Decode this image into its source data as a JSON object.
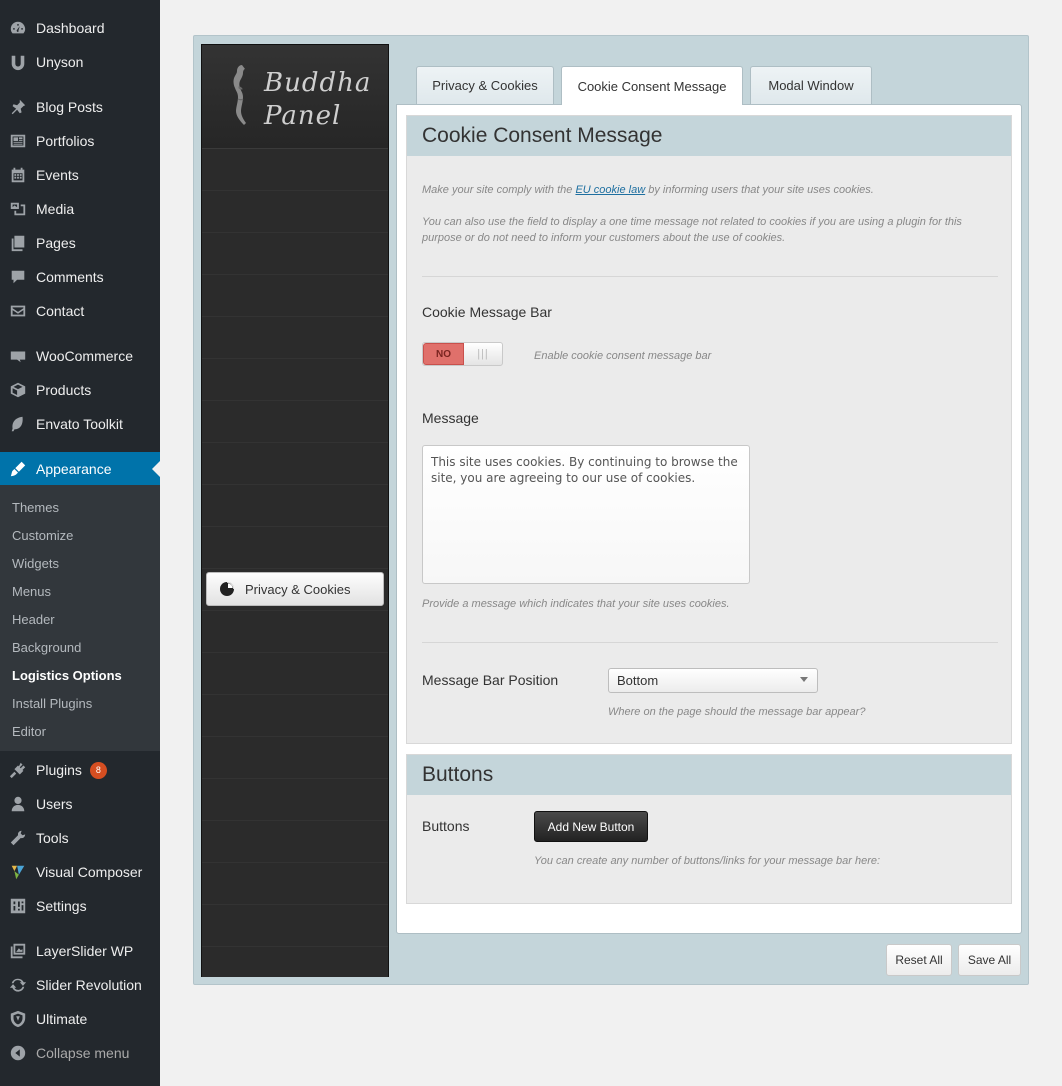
{
  "sidebar": {
    "items": [
      {
        "label": "Dashboard",
        "icon": "dashboard-icon"
      },
      {
        "label": "Unyson",
        "icon": "unyson-icon"
      },
      {
        "label": "Blog Posts",
        "icon": "pin-icon"
      },
      {
        "label": "Portfolios",
        "icon": "portfolio-icon"
      },
      {
        "label": "Events",
        "icon": "calendar-icon"
      },
      {
        "label": "Media",
        "icon": "media-icon"
      },
      {
        "label": "Pages",
        "icon": "pages-icon"
      },
      {
        "label": "Comments",
        "icon": "comment-icon"
      },
      {
        "label": "Contact",
        "icon": "mail-icon"
      },
      {
        "label": "WooCommerce",
        "icon": "woo-icon"
      },
      {
        "label": "Products",
        "icon": "box-icon"
      },
      {
        "label": "Envato Toolkit",
        "icon": "leaf-icon"
      },
      {
        "label": "Appearance",
        "icon": "brush-icon"
      },
      {
        "label": "Plugins",
        "icon": "plug-icon",
        "badge": "8"
      },
      {
        "label": "Users",
        "icon": "user-icon"
      },
      {
        "label": "Tools",
        "icon": "wrench-icon"
      },
      {
        "label": "Visual Composer",
        "icon": "vc-icon"
      },
      {
        "label": "Settings",
        "icon": "settings-icon"
      },
      {
        "label": "LayerSlider WP",
        "icon": "layers-icon"
      },
      {
        "label": "Slider Revolution",
        "icon": "refresh-icon"
      },
      {
        "label": "Ultimate",
        "icon": "shield-icon"
      },
      {
        "label": "Collapse menu",
        "icon": "collapse-icon"
      }
    ],
    "submenu": [
      "Themes",
      "Customize",
      "Widgets",
      "Menus",
      "Header",
      "Background",
      "Logistics Options",
      "Install Plugins",
      "Editor"
    ],
    "active_sub": "Logistics Options",
    "accent": "#0073aa",
    "badge_color": "#d54e21"
  },
  "panel": {
    "logo_line1": "Buddha",
    "logo_line2": "Panel",
    "nav_item": "Privacy & Cookies",
    "tabs": [
      "Privacy & Cookies",
      "Cookie Consent Message",
      "Modal Window"
    ],
    "active_tab": "Cookie Consent Message",
    "section1_title": "Cookie Consent Message",
    "intro_pre": "Make your site comply with the ",
    "intro_link": "EU cookie law",
    "intro_post": " by informing users that your site uses cookies.",
    "intro2": "You can also use the field to display a one time message not related to cookies if you are using a plugin for this purpose or do not need to inform your customers about the use of cookies.",
    "bar_label": "Cookie Message Bar",
    "toggle_value": "NO",
    "toggle_desc": "Enable cookie consent message bar",
    "message_label": "Message",
    "message_value": "This site uses cookies. By continuing to browse the site, you are agreeing to our use of cookies.",
    "message_desc": "Provide a message which indicates that your site uses cookies.",
    "position_label": "Message Bar Position",
    "position_value": "Bottom",
    "position_desc": "Where on the page should the message bar appear?",
    "section2_title": "Buttons",
    "buttons_label": "Buttons",
    "add_button": "Add New Button",
    "buttons_desc": "You can create any number of buttons/links for your message bar here:",
    "reset_label": "Reset All",
    "save_label": "Save All",
    "panel_bg": "#c4d5da",
    "toggle_off_color": "#e0706b"
  }
}
